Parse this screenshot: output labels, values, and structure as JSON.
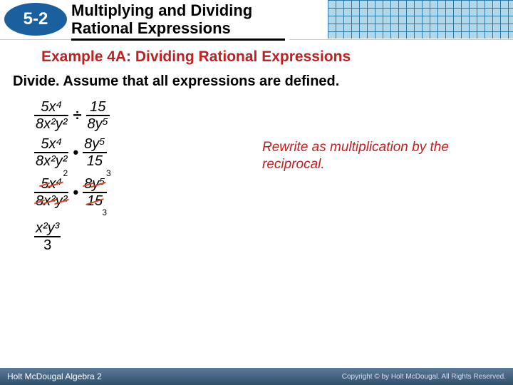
{
  "header": {
    "lesson": "5-2",
    "title_l1": "Multiplying and Dividing",
    "title_l2": "Rational Expressions"
  },
  "example_title": "Example 4A: Dividing Rational Expressions",
  "instruction": "Divide. Assume that all expressions are defined.",
  "step1": {
    "f1_num": "5x⁴",
    "f1_den": "8x²y²",
    "op": "÷",
    "f2_num": "15",
    "f2_den": "8y⁵"
  },
  "step2": {
    "f1_num": "5x⁴",
    "f1_den": "8x²y²",
    "op": "•",
    "f2_num": "8y⁵",
    "f2_den": "15"
  },
  "step3": {
    "a1": "5",
    "a2": "x⁴",
    "a2_ann": "2",
    "b1": "8",
    "b2": "x²",
    "b3": "y²",
    "c1": "8",
    "c2": "y⁵",
    "c2_ann": "3",
    "d1": "15",
    "d1_ann": "3",
    "op": "•"
  },
  "result": {
    "num": "x²y³",
    "den": "3"
  },
  "note": "Rewrite as multiplication by the reciprocal.",
  "footer": {
    "left": "Holt McDougal Algebra 2",
    "right": "Copyright © by Holt McDougal. All Rights Reserved."
  }
}
